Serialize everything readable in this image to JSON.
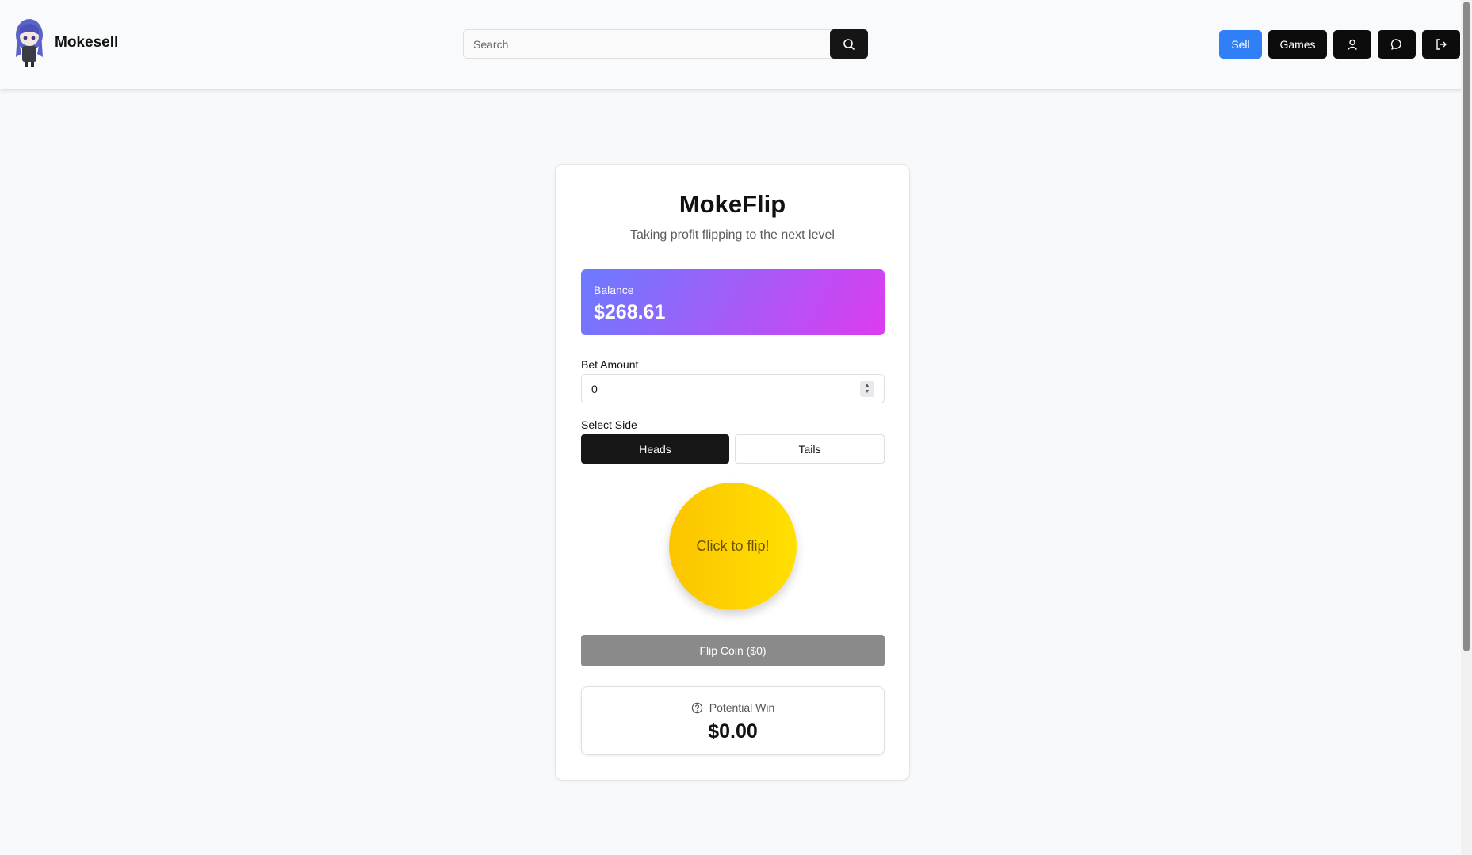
{
  "nav": {
    "brand_name": "Mokesell",
    "search_placeholder": "Search",
    "sell_label": "Sell",
    "games_label": "Games",
    "icons": [
      "user-icon",
      "chat-icon",
      "logout-icon"
    ]
  },
  "game": {
    "title": "MokeFlip",
    "subtitle": "Taking profit flipping to the next level",
    "balance_label": "Balance",
    "balance_amount": "$268.61",
    "bet_label": "Bet Amount",
    "bet_value": "0",
    "side_label": "Select Side",
    "sides": [
      "Heads",
      "Tails"
    ],
    "selected_side": "Heads",
    "coin_text": "Click to flip!",
    "flip_button": "Flip Coin ($0)",
    "potential_win_label": "Potential Win",
    "potential_win_amount": "$0.00"
  },
  "colors": {
    "sell_button": "#2f80f7",
    "dark_button": "#0c0c0c",
    "balance_gradient": [
      "#6a7bff",
      "#dc3cf0"
    ],
    "coin": "#fcc400",
    "flip_button_disabled": "#8a8a8a"
  }
}
